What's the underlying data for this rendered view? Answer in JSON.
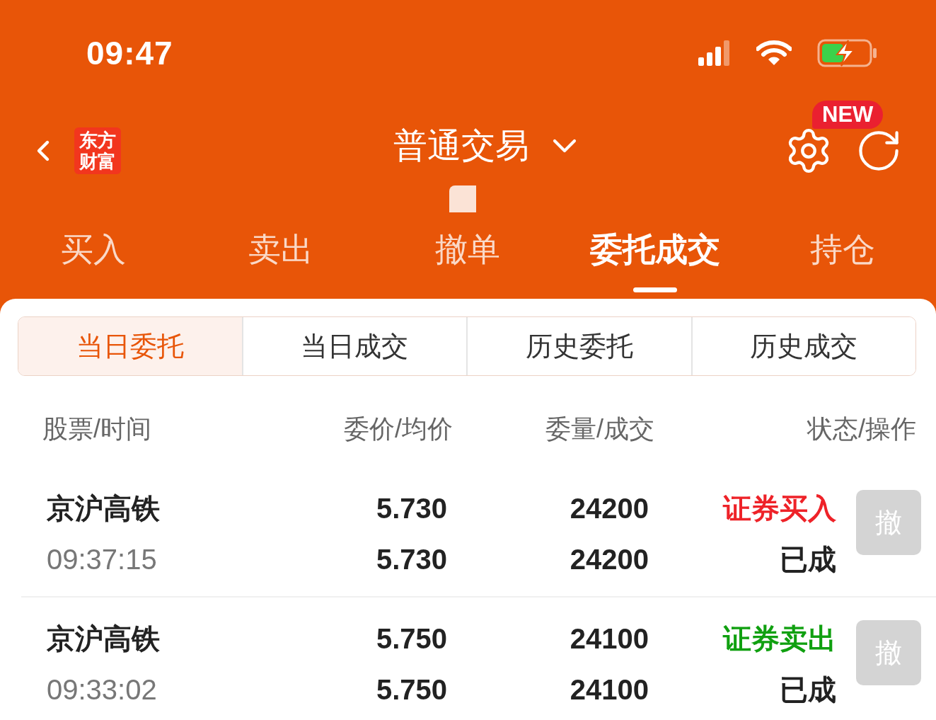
{
  "status_bar": {
    "time": "09:47"
  },
  "header": {
    "logo": "东方财富",
    "title": "普通交易",
    "badge": "NEW"
  },
  "main_tabs": [
    {
      "label": "买入",
      "selected": false
    },
    {
      "label": "卖出",
      "selected": false
    },
    {
      "label": "撤单",
      "selected": false
    },
    {
      "label": "委托成交",
      "selected": true
    },
    {
      "label": "持仓",
      "selected": false
    }
  ],
  "sub_tabs": [
    {
      "label": "当日委托",
      "selected": true
    },
    {
      "label": "当日成交",
      "selected": false
    },
    {
      "label": "历史委托",
      "selected": false
    },
    {
      "label": "历史成交",
      "selected": false
    }
  ],
  "columns": [
    "股票/时间",
    "委价/均价",
    "委量/成交",
    "状态/操作"
  ],
  "orders": [
    {
      "stock": "京沪高铁",
      "time": "09:37:15",
      "order_price": "5.730",
      "avg_price": "5.730",
      "order_qty": "24200",
      "filled_qty": "24200",
      "direction": "证券买入",
      "color": "#ee2228",
      "status": "已成",
      "cancel": {
        "label": "撤",
        "disabled": true
      }
    },
    {
      "stock": "京沪高铁",
      "time": "09:33:02",
      "order_price": "5.750",
      "avg_price": "5.750",
      "order_qty": "24100",
      "filled_qty": "24100",
      "direction": "证券卖出",
      "color": "#10a010",
      "status": "已成",
      "cancel": {
        "label": "撤",
        "disabled": true
      }
    }
  ]
}
